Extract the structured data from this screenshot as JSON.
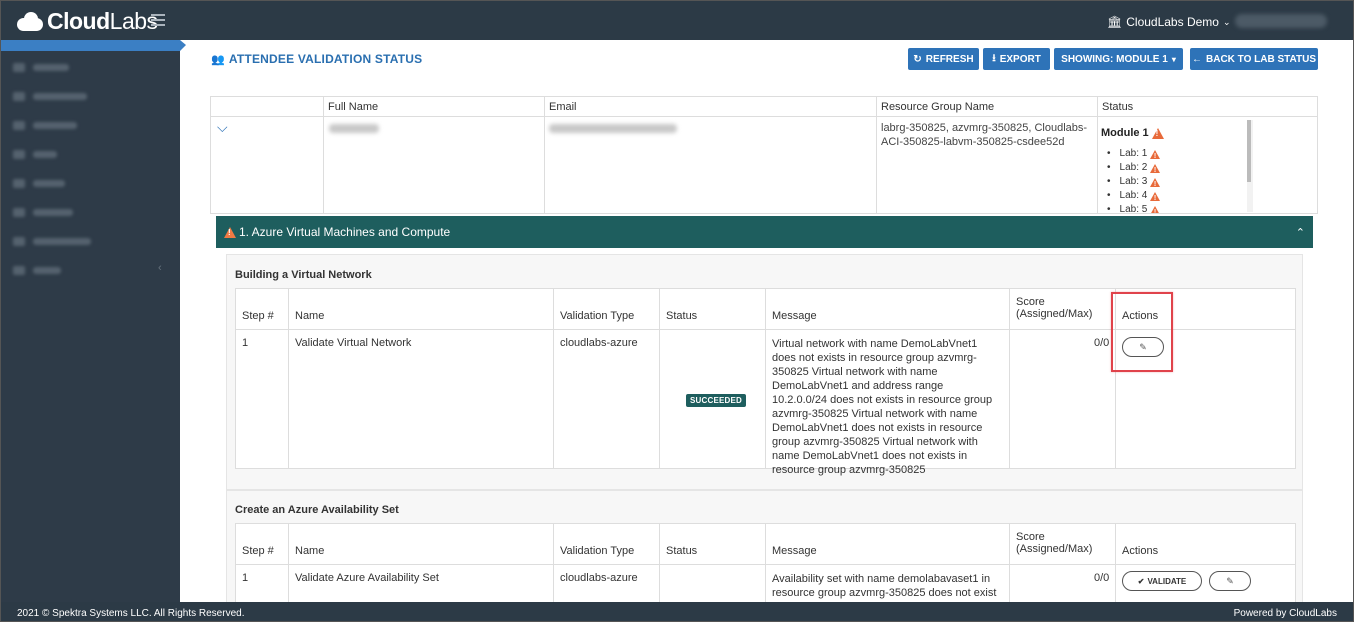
{
  "brand": {
    "logo_bold": "Cloud",
    "logo_light": "Labs"
  },
  "org_menu": {
    "label": "CloudLabs Demo"
  },
  "page": {
    "title": "ATTENDEE VALIDATION STATUS"
  },
  "toolbar": {
    "refresh": "REFRESH",
    "export": "EXPORT",
    "showing": "SHOWING: MODULE 1",
    "back": "BACK TO LAB STATUS"
  },
  "attendee_table": {
    "headers": [
      "Full Name",
      "Email",
      "Resource Group Name",
      "Status"
    ],
    "resource_groups": "labrg-350825, azvmrg-350825, Cloudlabs-ACI-350825-labvm-350825-csdee52d",
    "module_label": "Module 1",
    "labs": [
      "Lab: 1",
      "Lab: 2",
      "Lab: 3",
      "Lab: 4",
      "Lab: 5"
    ]
  },
  "section": {
    "title": "1. Azure Virtual Machines and Compute"
  },
  "validation_columns": {
    "step": "Step #",
    "name": "Name",
    "type": "Validation Type",
    "status": "Status",
    "message": "Message",
    "score_line1": "Score",
    "score_line2": "(Assigned/Max)",
    "actions": "Actions"
  },
  "groups": [
    {
      "title": "Building a Virtual Network",
      "row": {
        "step": "1",
        "name": "Validate Virtual Network",
        "type": "cloudlabs-azure",
        "status": "SUCCEEDED",
        "message": "Virtual network with name DemoLabVnet1 does not exists in resource group azvmrg-350825 Virtual network with name DemoLabVnet1 and address range 10.2.0.0/24 does not exists in resource group azvmrg-350825 Virtual network with name DemoLabVnet1 does not exists in resource group azvmrg-350825 Virtual network with name DemoLabVnet1 does not exists in resource group azvmrg-350825",
        "score": "0/0"
      }
    },
    {
      "title": "Create an Azure Availability Set",
      "row": {
        "step": "1",
        "name": "Validate Azure Availability Set",
        "type": "cloudlabs-azure",
        "status": "",
        "message": "Availability set with name demolabavaset1 in resource group azvmrg-350825 does not exist",
        "score": "0/0",
        "validate_label": "VALIDATE"
      }
    }
  ],
  "footer": {
    "copyright": "2021 © Spektra Systems LLC. All Rights Reserved.",
    "powered": "Powered by CloudLabs"
  },
  "colors": {
    "topbar": "#2c3a46",
    "primary_button": "#2e73b8",
    "section_band": "#1e5e5e",
    "warning": "#e86a3a",
    "highlight": "#e0434b"
  }
}
